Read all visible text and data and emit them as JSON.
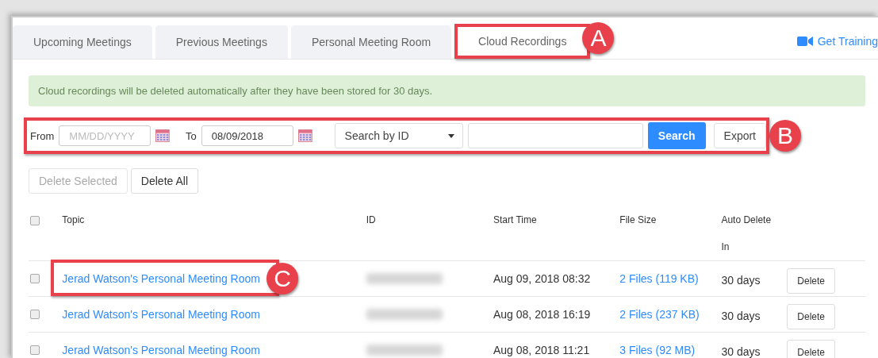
{
  "tabs": [
    {
      "label": "Upcoming Meetings",
      "selected": false
    },
    {
      "label": "Previous Meetings",
      "selected": false
    },
    {
      "label": "Personal Meeting Room",
      "selected": false
    },
    {
      "label": "Cloud Recordings",
      "selected": true,
      "callout": "A"
    }
  ],
  "training_link": "Get Training",
  "notice": "Cloud recordings will be deleted automatically after they have been stored for 30 days.",
  "filter": {
    "callout": "B",
    "from_label": "From",
    "from_placeholder": "MM/DD/YYYY",
    "to_label": "To",
    "to_value": "08/09/2018",
    "search_by": "Search by ID",
    "search_button": "Search",
    "export_button": "Export"
  },
  "bulk_actions": [
    {
      "label": "Delete Selected",
      "disabled": true
    },
    {
      "label": "Delete All",
      "disabled": false
    }
  ],
  "table": {
    "columns": [
      "Topic",
      "ID",
      "Start Time",
      "File Size",
      "Auto Delete In"
    ],
    "header_checked": false,
    "rows": [
      {
        "checked": false,
        "topic": "Jerad Watson's Personal Meeting Room",
        "callout": "C",
        "start_time": "Aug 09, 2018 08:32",
        "file_size": "2 Files (119 KB)",
        "auto_delete": "30 days",
        "action": "Delete"
      },
      {
        "checked": false,
        "topic": "Jerad Watson's Personal Meeting Room",
        "start_time": "Aug 08, 2018 16:19",
        "file_size": "2 Files (237 KB)",
        "auto_delete": "30 days",
        "action": "Delete"
      },
      {
        "checked": false,
        "topic": "Jerad Watson's Personal Meeting Room",
        "start_time": "Aug 08, 2018 11:21",
        "file_size": "3 Files (92 MB)",
        "auto_delete": "30 days",
        "action": "Delete"
      }
    ]
  }
}
